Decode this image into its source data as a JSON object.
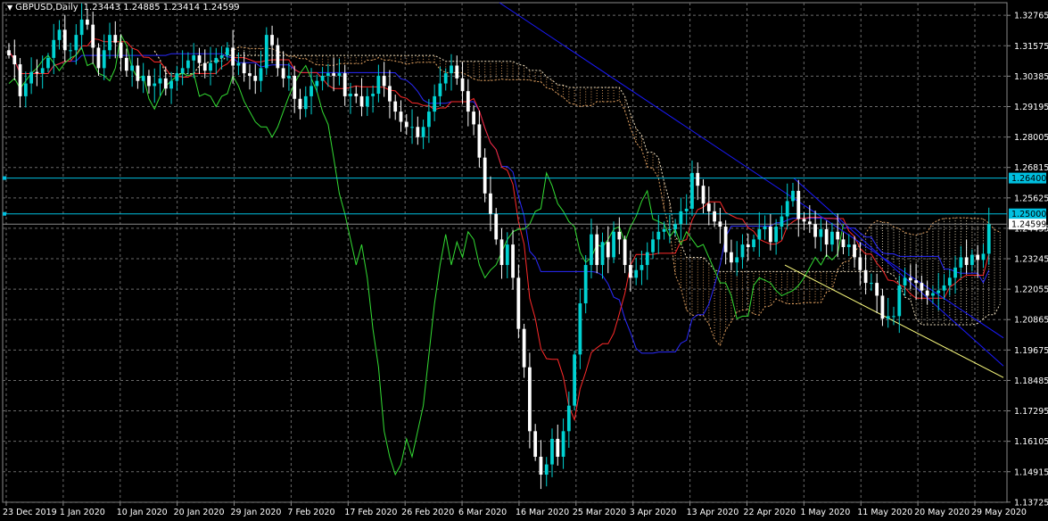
{
  "header": {
    "symbol": "GBPUSD",
    "timeframe": "Daily",
    "open": "1.23443",
    "high": "1.24885",
    "low": "1.23414",
    "close": "1.24599"
  },
  "colors": {
    "background": "#000000",
    "bull": "#00d2d2",
    "bear": "#ffffff",
    "grid": "#6a6a6a",
    "tenkan": "#ff2a2a",
    "kijun": "#2a2aff",
    "chikou": "#33dd33",
    "cloud_a": "#e0a060",
    "cloud_b": "#f0e0c0",
    "trend_blue": "#1a1aff",
    "trend_yellow": "#ffff80",
    "level": "#00c0e0"
  },
  "chart_data": {
    "type": "candlestick",
    "ylim": [
      1.1372,
      1.3326
    ],
    "y_ticks": [
      "1.32765",
      "1.31575",
      "1.30385",
      "1.29195",
      "1.28005",
      "1.26815",
      "1.25625",
      "1.24435",
      "1.23245",
      "1.22055",
      "1.20865",
      "1.19675",
      "1.18485",
      "1.17295",
      "1.16105",
      "1.14915",
      "1.13725"
    ],
    "x_ticks": [
      "23 Dec 2019",
      "1 Jan 2020",
      "10 Jan 2020",
      "20 Jan 2020",
      "29 Jan 2020",
      "7 Feb 2020",
      "17 Feb 2020",
      "26 Feb 2020",
      "6 Mar 2020",
      "16 Mar 2020",
      "25 Mar 2020",
      "3 Apr 2020",
      "13 Apr 2020",
      "22 Apr 2020",
      "1 May 2020",
      "11 May 2020",
      "20 May 2020",
      "29 May 2020"
    ],
    "levels": [
      {
        "value": 1.264,
        "label": "1.26400"
      },
      {
        "value": 1.25,
        "label": "1.25000"
      },
      {
        "value": 1.24599,
        "label": "1.24599"
      }
    ],
    "closes": [
      1.312,
      1.3085,
      1.296,
      1.301,
      1.3055,
      1.305,
      1.307,
      1.311,
      1.318,
      1.322,
      1.314,
      1.314,
      1.32,
      1.326,
      1.324,
      1.315,
      1.307,
      1.314,
      1.32,
      1.317,
      1.311,
      1.306,
      1.308,
      1.302,
      1.304,
      1.3,
      1.301,
      1.303,
      1.299,
      1.302,
      1.305,
      1.307,
      1.31,
      1.312,
      1.309,
      1.306,
      1.309,
      1.311,
      1.312,
      1.315,
      1.308,
      1.309,
      1.305,
      1.304,
      1.302,
      1.307,
      1.32,
      1.316,
      1.307,
      1.303,
      1.304,
      1.295,
      1.291,
      1.296,
      1.3,
      1.302,
      1.304,
      1.305,
      1.304,
      1.305,
      1.296,
      1.297,
      1.296,
      1.292,
      1.296,
      1.297,
      1.304,
      1.3,
      1.294,
      1.29,
      1.286,
      1.284,
      1.284,
      1.28,
      1.284,
      1.29,
      1.296,
      1.301,
      1.305,
      1.308,
      1.303,
      1.298,
      1.29,
      1.285,
      1.272,
      1.258,
      1.25,
      1.24,
      1.23,
      1.238,
      1.225,
      1.205,
      1.19,
      1.165,
      1.155,
      1.148,
      1.152,
      1.162,
      1.155,
      1.165,
      1.175,
      1.195,
      1.215,
      1.23,
      1.242,
      1.23,
      1.239,
      1.233,
      1.243,
      1.24,
      1.23,
      1.225,
      1.228,
      1.23,
      1.235,
      1.24,
      1.243,
      1.244,
      1.244,
      1.246,
      1.251,
      1.252,
      1.266,
      1.261,
      1.254,
      1.251,
      1.247,
      1.245,
      1.235,
      1.231,
      1.233,
      1.238,
      1.237,
      1.24,
      1.244,
      1.245,
      1.239,
      1.245,
      1.249,
      1.255,
      1.259,
      1.248,
      1.247,
      1.246,
      1.241,
      1.244,
      1.238,
      1.243,
      1.24,
      1.237,
      1.238,
      1.233,
      1.228,
      1.223,
      1.223,
      1.218,
      1.209,
      1.21,
      1.21,
      1.222,
      1.225,
      1.224,
      1.223,
      1.22,
      1.218,
      1.219,
      1.22,
      1.222,
      1.225,
      1.229,
      1.233,
      1.23,
      1.234,
      1.232,
      1.2344,
      1.246
    ]
  }
}
